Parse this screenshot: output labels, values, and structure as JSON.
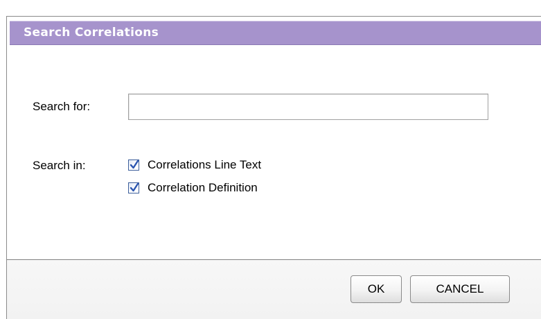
{
  "dialog": {
    "title": "Search Correlations",
    "title_bar_color": "#a693cc"
  },
  "search": {
    "label": "Search for:",
    "value": "",
    "placeholder": ""
  },
  "search_in": {
    "label": "Search in:",
    "options": [
      {
        "label": "Correlations Line Text",
        "checked": true
      },
      {
        "label": "Correlation Definition",
        "checked": true
      }
    ]
  },
  "buttons": {
    "ok_label": "OK",
    "cancel_label": "CANCEL"
  }
}
